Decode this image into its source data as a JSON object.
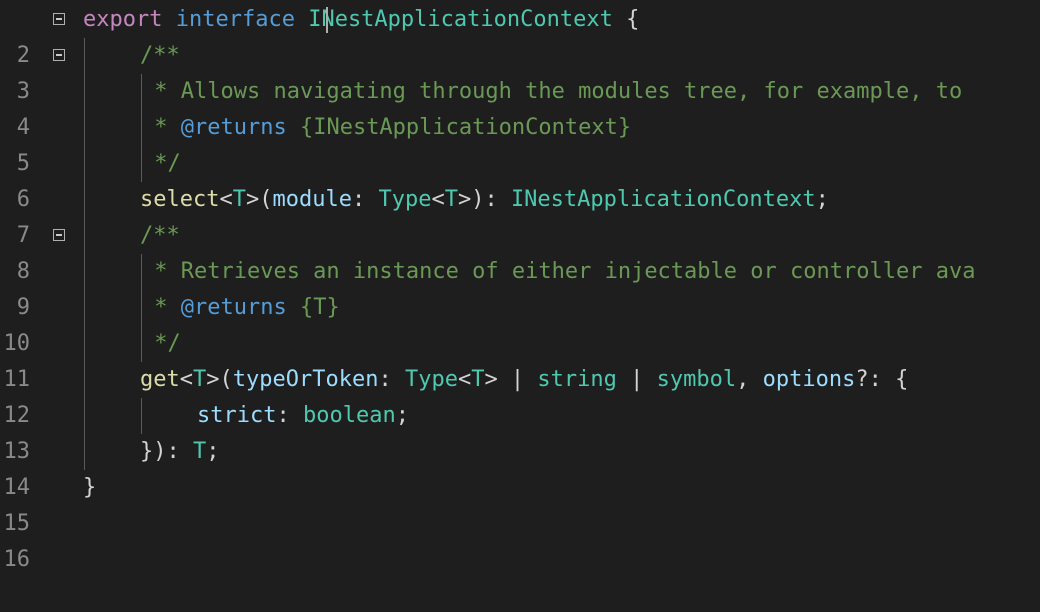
{
  "colors": {
    "background": "#1e1e1e",
    "keyword_pink": "#c586c0",
    "keyword_blue": "#569cd6",
    "type": "#4ec9b0",
    "comment": "#6a9955",
    "function": "#dcdcaa",
    "parameter": "#9cdcfe",
    "punctuation": "#d4d4d4",
    "line_number": "#8a8a8a"
  },
  "editor": {
    "line_numbers": [
      "2",
      "3",
      "4",
      "5",
      "6",
      "7",
      "8",
      "9",
      "10",
      "11",
      "12",
      "13",
      "14",
      "15",
      "16"
    ],
    "fold_icons": [
      "fold-icon",
      "fold-icon",
      "fold-icon"
    ],
    "code": {
      "l2": [
        "export",
        " ",
        "interface",
        " ",
        "INestApplicationContext",
        " {"
      ],
      "l3": [
        "/**"
      ],
      "l4": [
        " * Allows navigating through the modules tree, for example, to"
      ],
      "l5": [
        " * ",
        "@returns",
        " {INestApplicationContext}"
      ],
      "l6": [
        " */"
      ],
      "l7": [
        "select",
        "<",
        "T",
        ">(",
        "module",
        ": ",
        "Type",
        "<",
        "T",
        ">): ",
        "INestApplicationContext",
        ";"
      ],
      "l8": [
        "/**"
      ],
      "l9": [
        " * Retrieves an instance of either injectable or controller ava"
      ],
      "l10": [
        " * ",
        "@returns",
        " {T}"
      ],
      "l11": [
        " */"
      ],
      "l12": [
        "get",
        "<",
        "T",
        ">(",
        "typeOrToken",
        ": ",
        "Type",
        "<",
        "T",
        "> | ",
        "string",
        " | ",
        "symbol",
        ", ",
        "options",
        "?: {"
      ],
      "l13": [
        "strict",
        ": ",
        "boolean",
        ";"
      ],
      "l14": [
        "}): ",
        "T",
        ";"
      ],
      "l15": [
        "}"
      ],
      "l16": [
        ""
      ]
    }
  }
}
